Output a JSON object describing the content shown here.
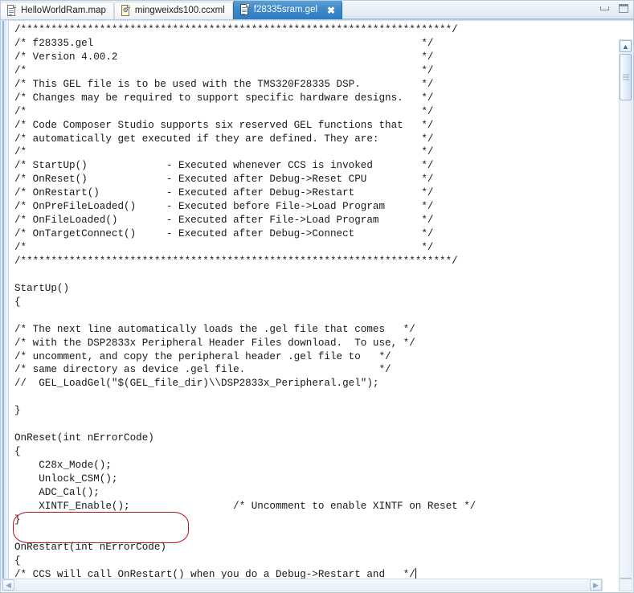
{
  "window": {
    "minimize_label": "Minimize",
    "maximize_label": "Maximize"
  },
  "tabs": [
    {
      "label": "HelloWorldRam.map",
      "icon": "map-file-icon",
      "active": false,
      "closable": false
    },
    {
      "label": "mingweixds100.ccxml",
      "icon": "xml-file-icon",
      "active": false,
      "closable": false
    },
    {
      "label": "f28335sram.gel",
      "icon": "gel-file-icon",
      "active": true,
      "closable": true,
      "close_glyph": "✖"
    }
  ],
  "editor": {
    "filename": "f28335sram.gel",
    "language": "gel",
    "caret_glyph": "",
    "lines": [
      "/***********************************************************************/",
      "/* f28335.gel                                                      */",
      "/* Version 4.00.2                                                  */",
      "/*                                                                 */",
      "/* This GEL file is to be used with the TMS320F28335 DSP.          */",
      "/* Changes may be required to support specific hardware designs.   */",
      "/*                                                                 */",
      "/* Code Composer Studio supports six reserved GEL functions that   */",
      "/* automatically get executed if they are defined. They are:       */",
      "/*                                                                 */",
      "/* StartUp()             - Executed whenever CCS is invoked        */",
      "/* OnReset()             - Executed after Debug->Reset CPU         */",
      "/* OnRestart()           - Executed after Debug->Restart           */",
      "/* OnPreFileLoaded()     - Executed before File->Load Program      */",
      "/* OnFileLoaded()        - Executed after File->Load Program       */",
      "/* OnTargetConnect()     - Executed after Debug->Connect           */",
      "/*                                                                 */",
      "/***********************************************************************/",
      "",
      "StartUp()",
      "{",
      "",
      "/* The next line automatically loads the .gel file that comes   */",
      "/* with the DSP2833x Peripheral Header Files download.  To use, */",
      "/* uncomment, and copy the peripheral header .gel file to   */",
      "/* same directory as device .gel file.                      */",
      "//  GEL_LoadGel(\"$(GEL_file_dir)\\\\DSP2833x_Peripheral.gel\");",
      "",
      "}",
      "",
      "OnReset(int nErrorCode)",
      "{",
      "    C28x_Mode();",
      "    Unlock_CSM();",
      "    ADC_Cal();",
      "    XINTF_Enable();                 /* Uncomment to enable XINTF on Reset */",
      "}",
      "",
      "OnRestart(int nErrorCode)",
      "{",
      "/* CCS will call OnRestart() when you do a Debug->Restart and   */"
    ]
  },
  "annotation": {
    "shape": "rounded-rectangle",
    "color": "#b01722",
    "target_text": "XINTF_Enable();"
  },
  "scrollbars": {
    "vertical": {
      "up_glyph": "▲",
      "down_glyph": "▼",
      "thumb_position_pct": 2,
      "thumb_size_pct": 8
    },
    "horizontal": {
      "left_glyph": "◀",
      "right_glyph": "▶"
    }
  }
}
